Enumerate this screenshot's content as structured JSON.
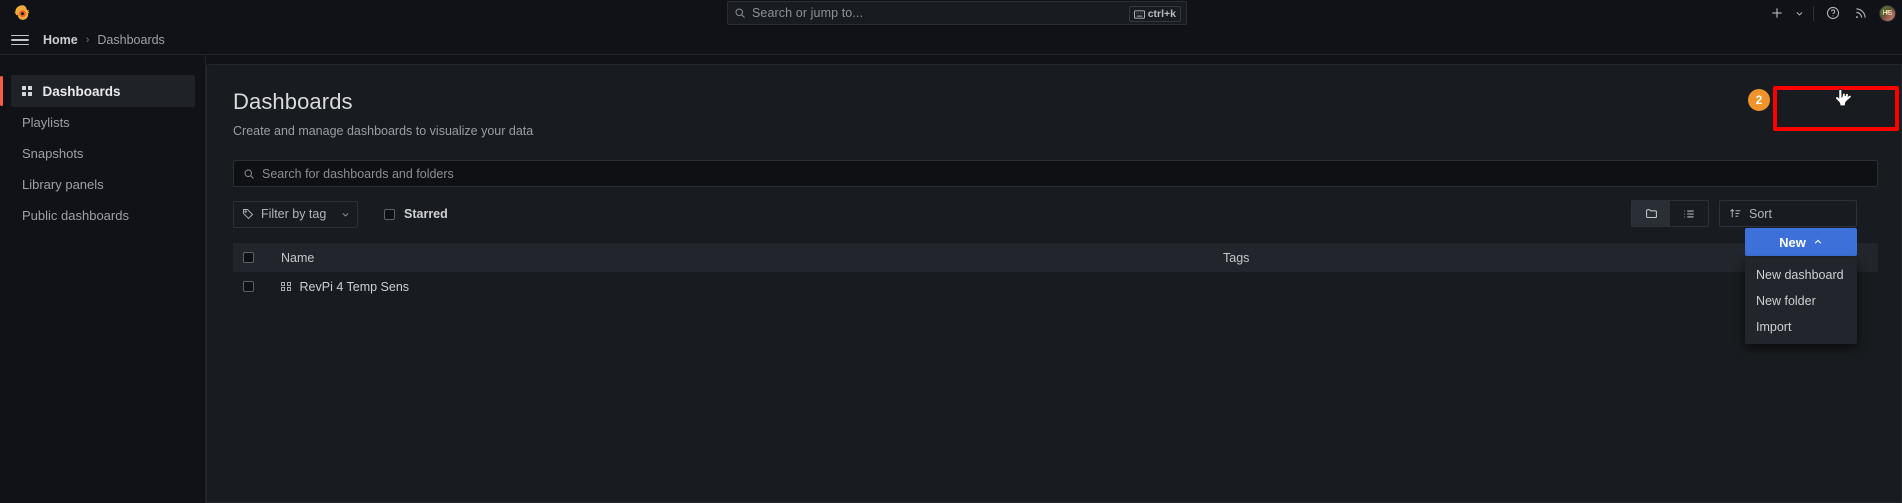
{
  "topbar": {
    "logo_icon": "grafana-logo-icon",
    "search": {
      "placeholder": "Search or jump to...",
      "icon": "search-icon",
      "shortcut": "ctrl+k",
      "shortcut_icon": "keyboard-icon"
    },
    "actions": [
      {
        "name": "new-quick-add-button",
        "icon": "plus-icon"
      },
      {
        "name": "quick-add-chevron",
        "icon": "chevron-down-icon"
      },
      {
        "name": "help-button",
        "icon": "question-circle-icon"
      },
      {
        "name": "news-button",
        "icon": "rss-icon"
      },
      {
        "name": "user-avatar",
        "icon": "avatar-icon",
        "initials": "HS"
      }
    ]
  },
  "breadcrumb": {
    "menu_icon": "hamburger-menu-icon",
    "items": [
      {
        "label": "Home"
      },
      {
        "label": "Dashboards"
      }
    ],
    "separator": "›"
  },
  "sidebar": {
    "items": [
      {
        "label": "Dashboards",
        "icon": "apps-grid-icon",
        "active": true
      },
      {
        "label": "Playlists",
        "active": false
      },
      {
        "label": "Snapshots",
        "active": false
      },
      {
        "label": "Library panels",
        "active": false
      },
      {
        "label": "Public dashboards",
        "active": false
      }
    ]
  },
  "main": {
    "title": "Dashboards",
    "subtitle": "Create and manage dashboards to visualize your data",
    "search": {
      "placeholder": "Search for dashboards and folders",
      "icon": "search-icon",
      "value": ""
    },
    "filters": {
      "tag_filter_label": "Filter by tag",
      "tag_filter_icon": "tag-icon",
      "tag_filter_chevron": "chevron-down-icon",
      "starred_label": "Starred",
      "starred_checked": false
    },
    "view_toggle": {
      "folder_view_icon": "folder-icon",
      "list_view_icon": "list-icon",
      "active": "folder"
    },
    "sort_button": {
      "label": "Sort",
      "icon": "sort-amount-down-icon"
    },
    "table": {
      "columns": [
        "Name",
        "Tags"
      ],
      "header_checkbox_checked": false,
      "rows": [
        {
          "checked": false,
          "icon": "dashboard-grid-icon",
          "name": "RevPi 4 Temp Sens",
          "tags": ""
        }
      ]
    },
    "new_menu": {
      "button_label": "New",
      "button_chevron": "chevron-up-icon",
      "button_color": "#3d71d9",
      "open": true,
      "items": [
        {
          "label": "New dashboard"
        },
        {
          "label": "New folder"
        },
        {
          "label": "Import"
        }
      ]
    }
  },
  "annotation": {
    "badge_number": "2",
    "badge_color": "#f0932b",
    "highlight_color": "#ff0000",
    "cursor_icon": "pointer-hand-cursor"
  }
}
